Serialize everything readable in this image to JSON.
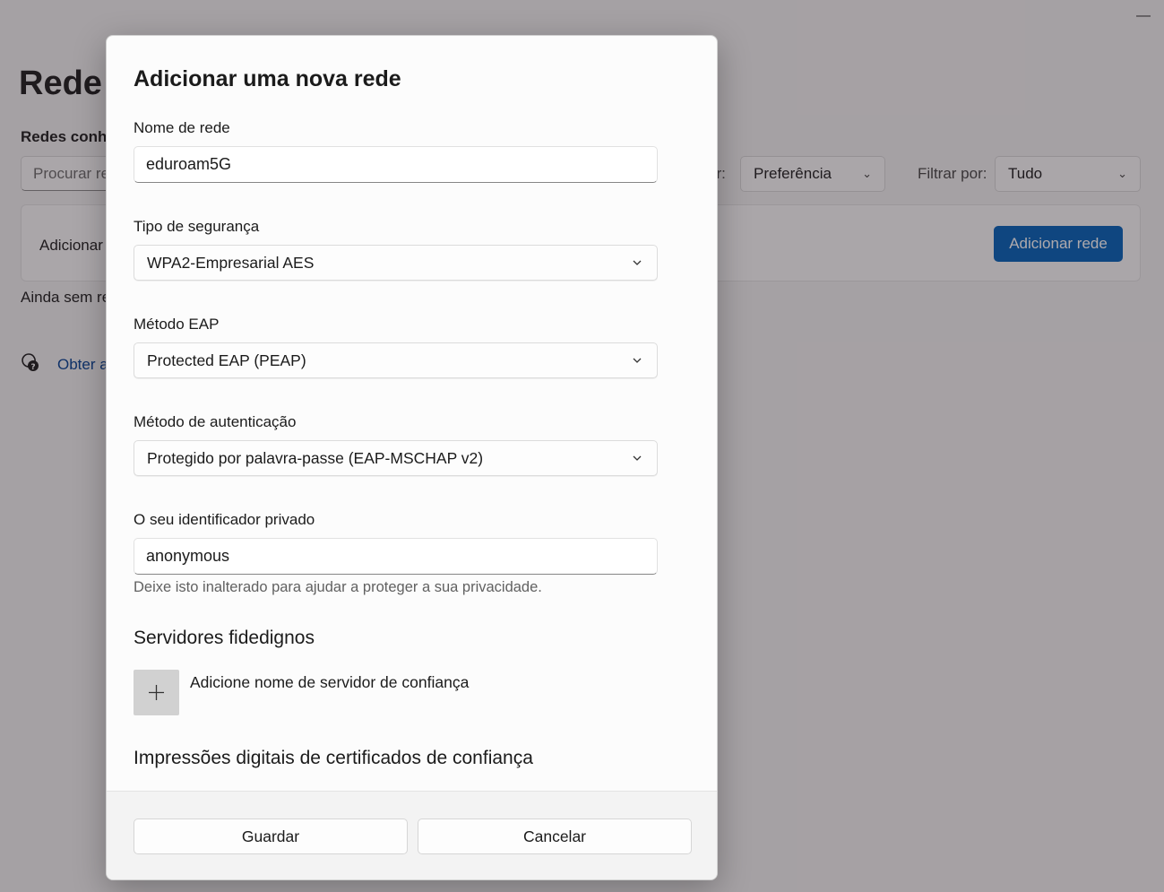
{
  "window": {
    "minimize_glyph": "—"
  },
  "background": {
    "page_title_start": "Rede e",
    "page_title_end": "s",
    "section_label": "Redes conhe",
    "search_placeholder": "Procurar re",
    "sort_label": "or:",
    "sort_value": "Preferência",
    "filter_label": "Filtrar por:",
    "filter_value": "Tudo",
    "add_card_label": "Adicionar",
    "add_network_button": "Adicionar rede",
    "empty_text": "Ainda sem re",
    "help_link": "Obter a",
    "accent_color": "#005fb8"
  },
  "dialog": {
    "title": "Adicionar uma nova rede",
    "network_name": {
      "label": "Nome de rede",
      "value": "eduroam5G"
    },
    "security_type": {
      "label": "Tipo de segurança",
      "value": "WPA2-Empresarial AES"
    },
    "eap_method": {
      "label": "Método EAP",
      "value": "Protected EAP (PEAP)"
    },
    "auth_method": {
      "label": "Método de autenticação",
      "value": "Protegido por palavra-passe (EAP-MSCHAP v2)"
    },
    "private_id": {
      "label": "O seu identificador privado",
      "value": "anonymous",
      "helper": "Deixe isto inalterado para ajudar a proteger a sua privacidade."
    },
    "trusted_servers": {
      "heading": "Servidores fidedignos",
      "add_label": "Adicione nome de servidor de confiança"
    },
    "cert_heading": "Impressões digitais de certificados de confiança",
    "save_button": "Guardar",
    "cancel_button": "Cancelar"
  }
}
